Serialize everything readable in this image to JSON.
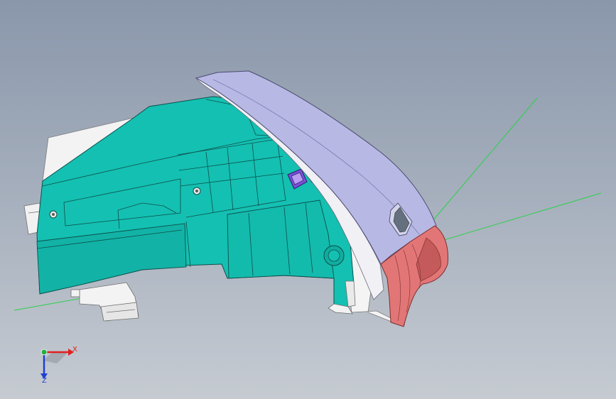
{
  "viewport": {
    "background_top": "#8a97ab",
    "background_bottom": "#c6cbd2"
  },
  "model": {
    "colors": {
      "body": "#14c0b2",
      "body_shadow": "#0ea497",
      "outline": "#0d4f4a",
      "cover": "#b7b8e4",
      "cover_edge": "#e4e5f2",
      "inner_white": "#f3f3f3",
      "end_cap": "#e27676",
      "end_cap_shadow": "#c45a5a",
      "clip": "#7a4fd8",
      "construction_line": "#2bd14a"
    },
    "icons": [
      "model-part-icon",
      "construction-line-icon"
    ]
  },
  "triad": {
    "x_label": "X",
    "z_label": "Z",
    "x_color": "#e02020",
    "y_color": "#20b040",
    "z_color": "#2040d0"
  }
}
